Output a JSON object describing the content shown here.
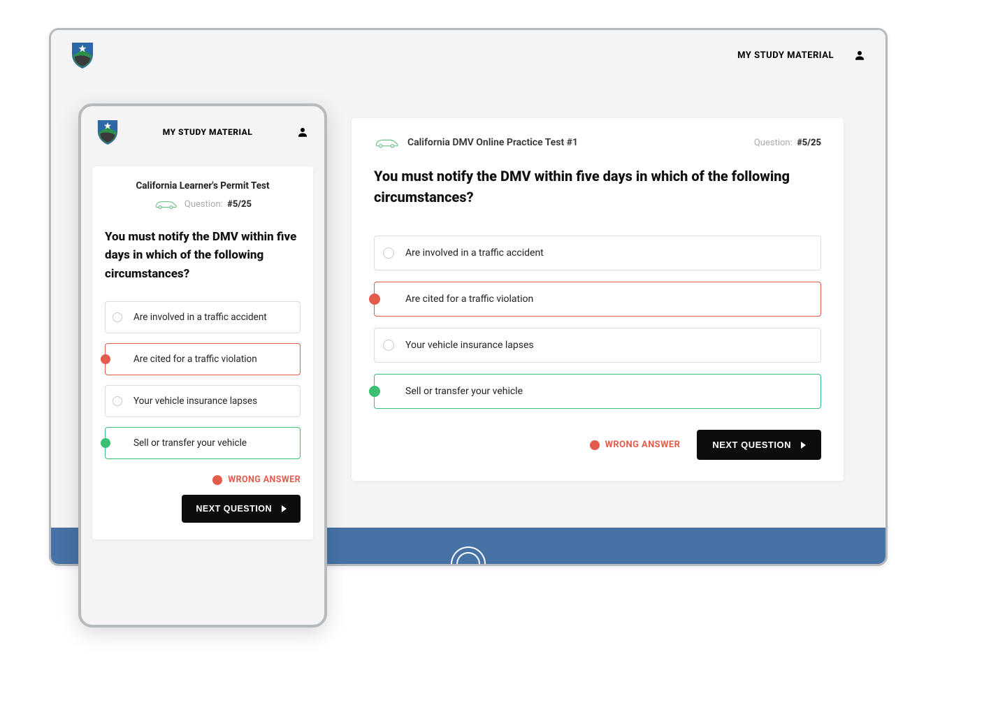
{
  "header": {
    "study_material": "MY STUDY MATERIAL"
  },
  "desktop": {
    "test_title": "California DMV Online Practice Test #1",
    "question_label": "Question:",
    "question_number": "#5/25",
    "question_text": "You must notify the DMV within five days in which of the following circumstances?",
    "options": [
      {
        "text": "Are involved in a traffic accident",
        "state": "default"
      },
      {
        "text": "Are cited for a traffic violation",
        "state": "wrong"
      },
      {
        "text": "Your vehicle insurance lapses",
        "state": "default"
      },
      {
        "text": "Sell or transfer your vehicle",
        "state": "correct"
      }
    ],
    "wrong_answer_label": "WRONG ANSWER",
    "next_button": "NEXT QUESTION"
  },
  "mobile": {
    "test_title": "California Learner's Permit Test",
    "question_label": "Question:",
    "question_number": "#5/25",
    "question_text": "You must notify the DMV within five days in which of the following circumstances?",
    "options": [
      {
        "text": "Are involved in a traffic accident",
        "state": "default"
      },
      {
        "text": "Are cited for a traffic violation",
        "state": "wrong"
      },
      {
        "text": "Your vehicle insurance lapses",
        "state": "default"
      },
      {
        "text": "Sell or transfer your vehicle",
        "state": "correct"
      }
    ],
    "wrong_answer_label": "WRONG ANSWER",
    "next_button": "NEXT QUESTION"
  },
  "colors": {
    "wrong": "#e35b4b",
    "correct": "#3bbf73",
    "footer": "#4672a5"
  }
}
